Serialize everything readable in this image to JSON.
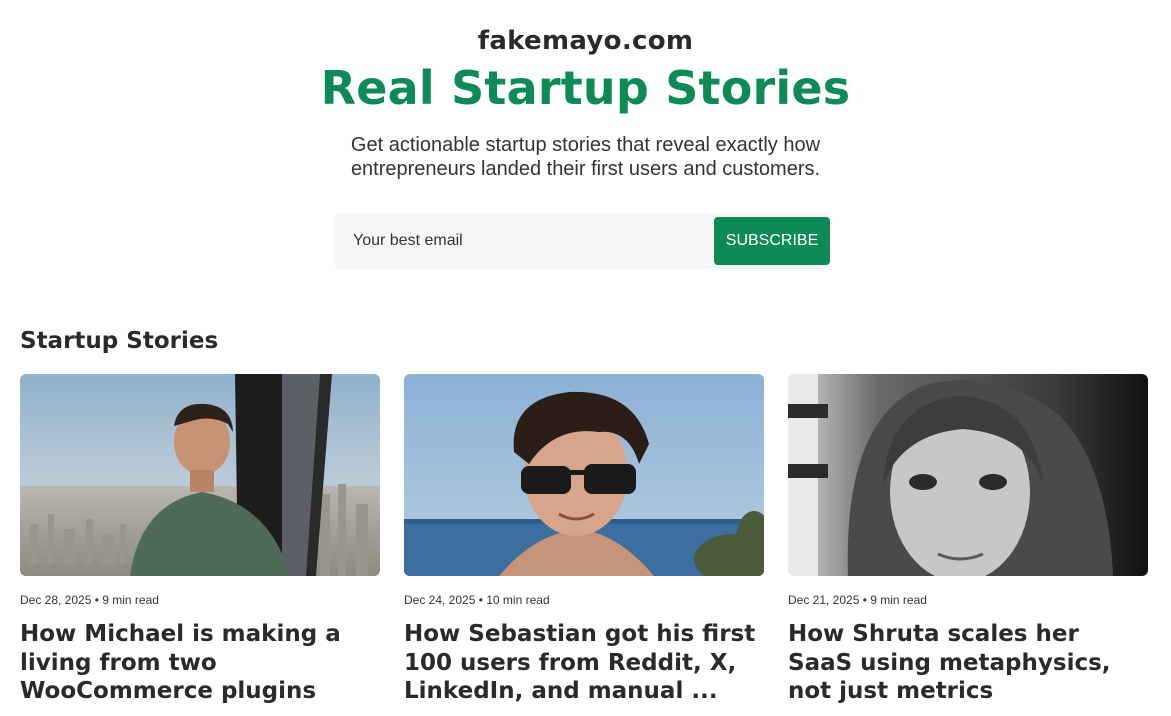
{
  "hero": {
    "site_name": "fakemayo.com",
    "headline": "Real Startup Stories",
    "tagline": "Get actionable startup stories that reveal exactly how entrepreneurs landed their first users and customers."
  },
  "subscribe": {
    "email_placeholder": "Your best email",
    "button_label": "SUBSCRIBE"
  },
  "section": {
    "title": "Startup Stories"
  },
  "stories": [
    {
      "date": "Dec 28, 2025",
      "read_time": "9 min read",
      "meta": "Dec 28, 2025 • 9 min read",
      "title": "How Michael is making a living from two WooCommerce plugins"
    },
    {
      "date": "Dec 24, 2025",
      "read_time": "10 min read",
      "meta": "Dec 24, 2025 • 10 min read",
      "title": "How Sebastian got his first 100 users from Reddit, X, LinkedIn, and manual ..."
    },
    {
      "date": "Dec 21, 2025",
      "read_time": "9 min read",
      "meta": "Dec 21, 2025 • 9 min read",
      "title": "How Shruta scales her SaaS using metaphysics, not just metrics"
    }
  ],
  "colors": {
    "accent": "#0d8a55",
    "text_dark": "#2a2a2a",
    "input_bg": "#f6f6f6"
  }
}
